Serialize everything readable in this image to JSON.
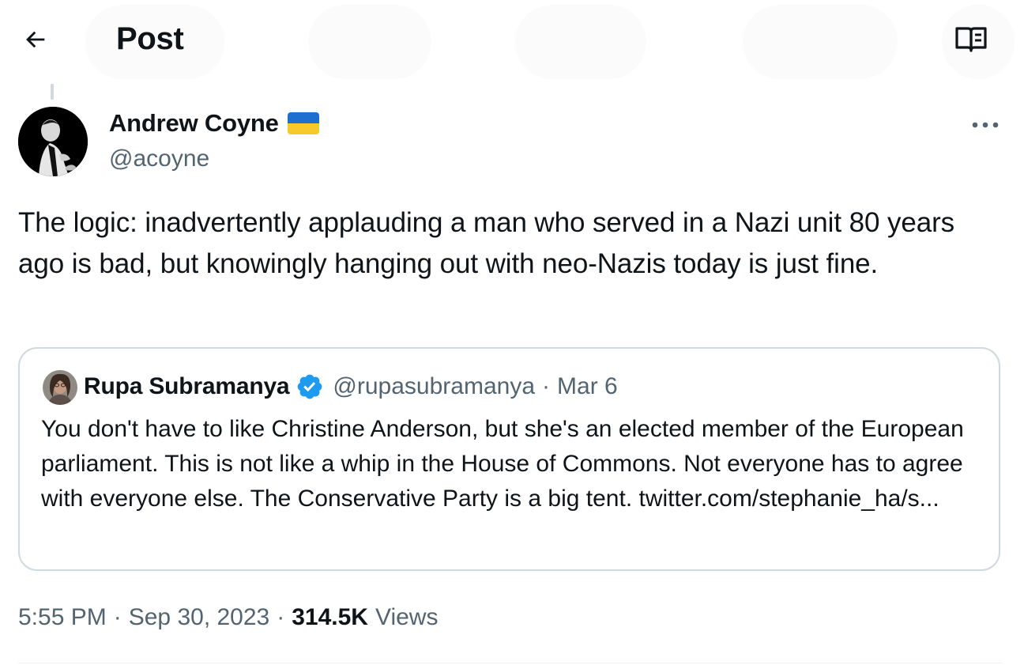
{
  "header": {
    "title": "Post",
    "back_icon": "arrow-left-icon",
    "reader_icon": "book-open-icon"
  },
  "tweet": {
    "author": {
      "name": "Andrew Coyne",
      "handle": "@acoyne",
      "flag": "ukraine-flag-icon"
    },
    "text": "The logic: inadvertently applauding a man who served in a Nazi unit 80 years ago is bad, but knowingly hanging out with neo-Nazis today is just fine.",
    "quote": {
      "name": "Rupa Subramanya",
      "handle": "@rupasubramanya",
      "separator": "·",
      "date": "Mar 6",
      "text": "You don't have to like Christine Anderson, but she's an elected member of the European parliament. This is not like a whip in the House of Commons. Not everyone has to agree with everyone else. The Conservative Party is a big tent. twitter.com/stephanie_ha/s..."
    },
    "meta": {
      "time": "5:55 PM",
      "separator": "·",
      "date": "Sep 30, 2023",
      "views_count": "314.5K",
      "views_label": "Views"
    }
  },
  "colors": {
    "text_primary": "#0f1419",
    "text_secondary": "#536471",
    "border": "#cfd9de",
    "verified_blue": "#1d9bf0",
    "flag_blue": "#1f6fd1",
    "flag_yellow": "#f7c92a"
  }
}
